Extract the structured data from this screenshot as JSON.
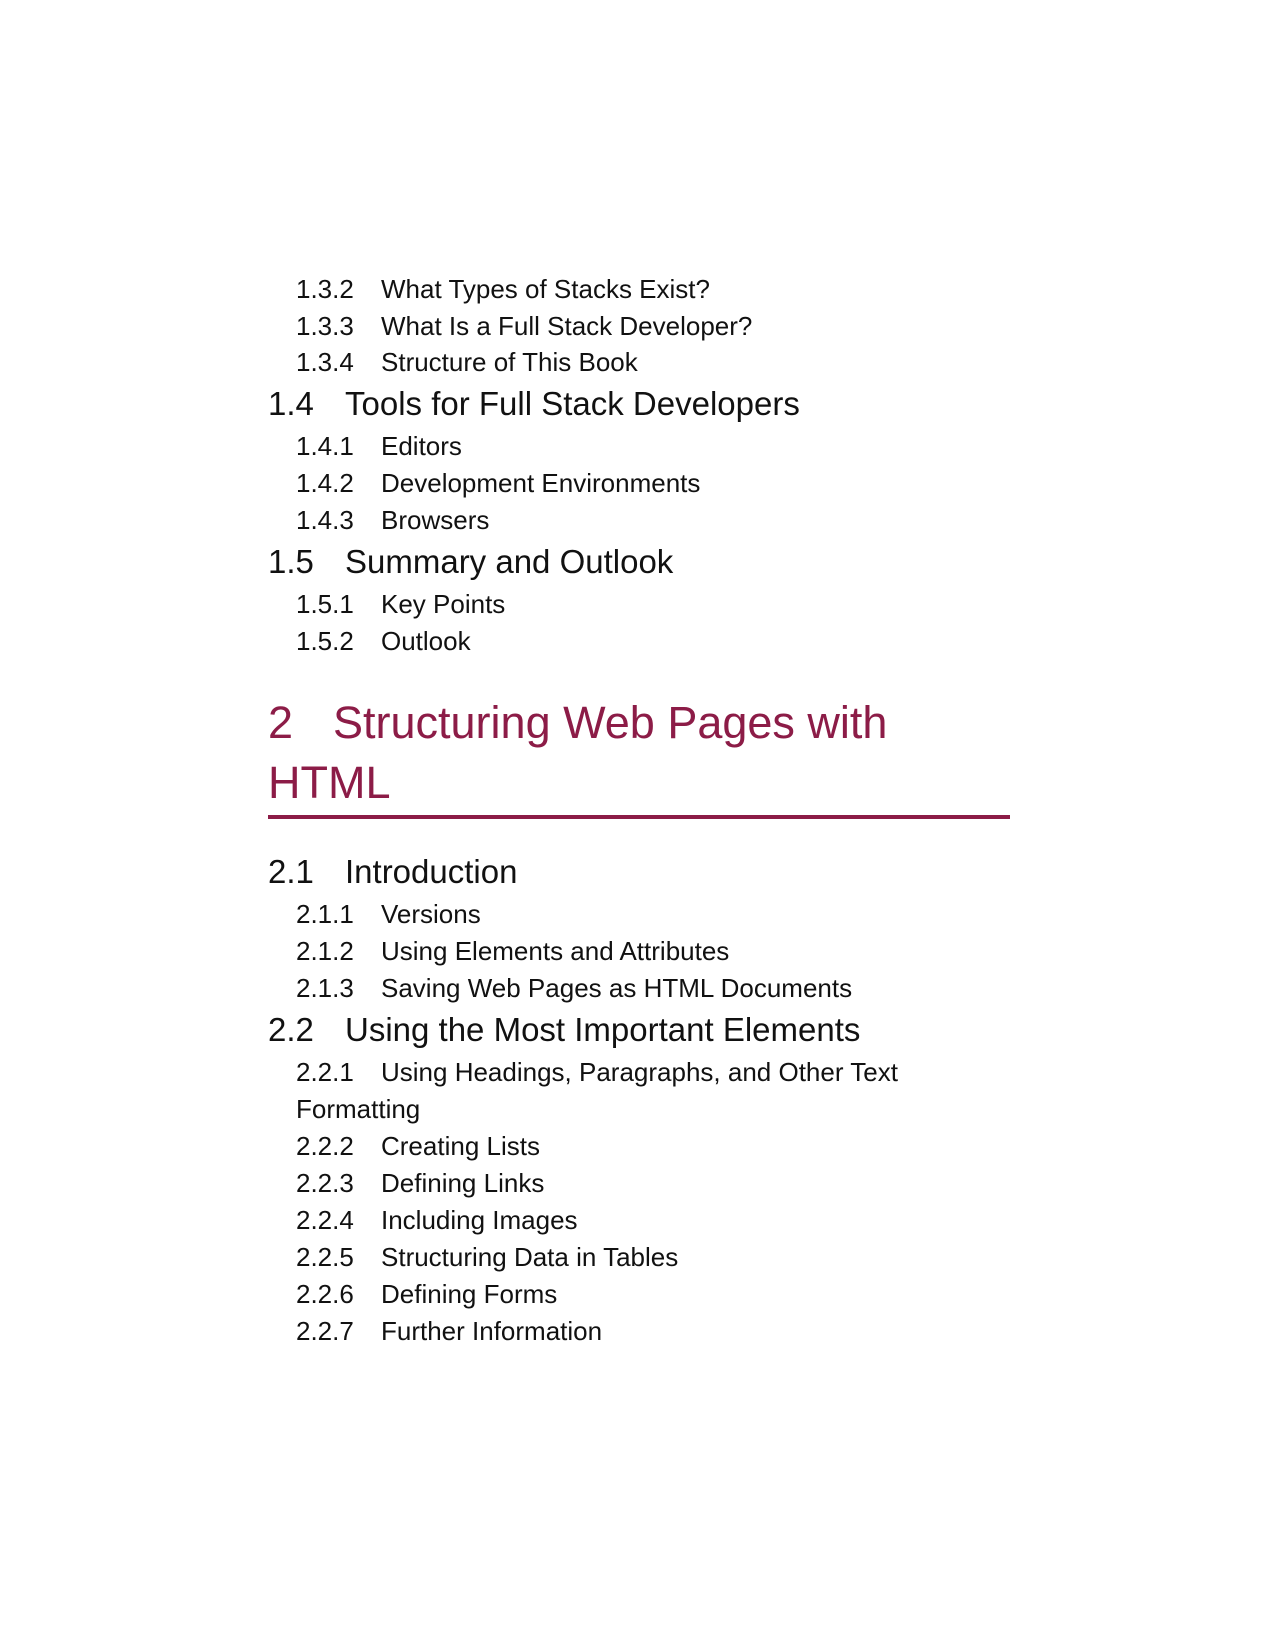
{
  "toc": {
    "e132": {
      "num": "1.3.2",
      "title": "What Types of Stacks Exist?"
    },
    "e133": {
      "num": "1.3.3",
      "title": "What Is a Full Stack Developer?"
    },
    "e134": {
      "num": "1.3.4",
      "title": "Structure of This Book"
    },
    "s14": {
      "num": "1.4",
      "title": "Tools for Full Stack Developers"
    },
    "e141": {
      "num": "1.4.1",
      "title": "Editors"
    },
    "e142": {
      "num": "1.4.2",
      "title": "Development Environments"
    },
    "e143": {
      "num": "1.4.3",
      "title": "Browsers"
    },
    "s15": {
      "num": "1.5",
      "title": "Summary and Outlook"
    },
    "e151": {
      "num": "1.5.1",
      "title": "Key Points"
    },
    "e152": {
      "num": "1.5.2",
      "title": "Outlook"
    },
    "chapter2": {
      "num": "2",
      "title_line1": "Structuring Web Pages with",
      "title_line2": "HTML"
    },
    "s21": {
      "num": "2.1",
      "title": "Introduction"
    },
    "e211": {
      "num": "2.1.1",
      "title": "Versions"
    },
    "e212": {
      "num": "2.1.2",
      "title": "Using Elements and Attributes"
    },
    "e213": {
      "num": "2.1.3",
      "title": "Saving Web Pages as HTML Documents"
    },
    "s22": {
      "num": "2.2",
      "title": "Using the Most Important Elements"
    },
    "e221": {
      "num": "2.2.1",
      "title_line1": "Using Headings, Paragraphs, and Other Text",
      "title_line2": "Formatting"
    },
    "e222": {
      "num": "2.2.2",
      "title": "Creating Lists"
    },
    "e223": {
      "num": "2.2.3",
      "title": "Defining Links"
    },
    "e224": {
      "num": "2.2.4",
      "title": "Including Images"
    },
    "e225": {
      "num": "2.2.5",
      "title": "Structuring Data in Tables"
    },
    "e226": {
      "num": "2.2.6",
      "title": "Defining Forms"
    },
    "e227": {
      "num": "2.2.7",
      "title": "Further Information"
    }
  },
  "colors": {
    "chapter_heading": "#8c1c47",
    "text": "#111111",
    "background": "#ffffff"
  }
}
